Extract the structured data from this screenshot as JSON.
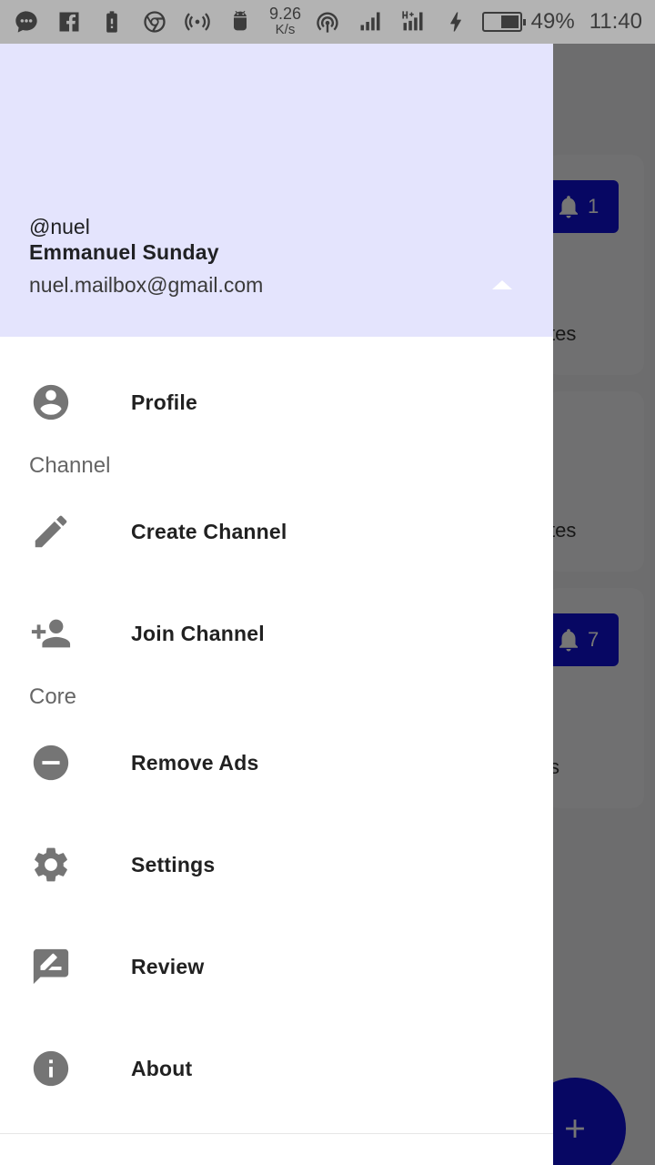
{
  "status_bar": {
    "net_speed": "9.26",
    "net_speed_unit": "K/s",
    "battery_percent": "49%",
    "battery_level": 0.49,
    "time": "11:40",
    "icons": [
      "chat-bubble-icon",
      "facebook-icon",
      "battery-alert-icon",
      "chrome-icon",
      "hotspot-icon",
      "android-icon",
      "nfc-icon",
      "signal-icon",
      "signal-hplus-icon",
      "charging-icon"
    ]
  },
  "background": {
    "badge_1_count": "1",
    "badge_2_count": "7",
    "card_1_text": "tes",
    "card_2_text": "tes",
    "card_3_text": "s",
    "fab_icon": "plus-icon"
  },
  "drawer": {
    "header": {
      "username": "@nuel",
      "full_name": "Emmanuel Sunday",
      "email": "nuel.mailbox@gmail.com",
      "background": "#e4e4fd"
    },
    "items": [
      {
        "label": "Profile",
        "icon": "account-circle-icon"
      },
      {
        "label": "Create Channel",
        "icon": "pencil-icon"
      },
      {
        "label": "Join Channel",
        "icon": "person-add-icon"
      },
      {
        "label": "Remove Ads",
        "icon": "remove-circle-icon"
      },
      {
        "label": "Settings",
        "icon": "gear-icon"
      },
      {
        "label": "Review",
        "icon": "rate-review-icon"
      },
      {
        "label": "About",
        "icon": "info-icon"
      }
    ],
    "sections": {
      "channel": "Channel",
      "core": "Core"
    }
  },
  "colors": {
    "accent": "#1010d8",
    "icon_gray": "#757575"
  }
}
